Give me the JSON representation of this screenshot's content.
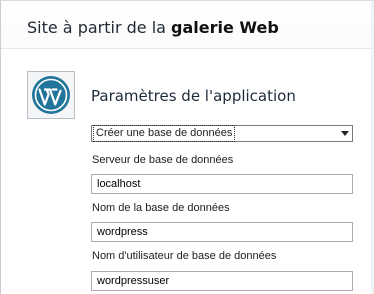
{
  "header": {
    "title_prefix": "Site à partir de la ",
    "title_bold": "galerie Web"
  },
  "app": {
    "logo_icon": "wordpress-icon",
    "section_title": "Paramètres de l'application"
  },
  "database_mode": {
    "selected": "Créer une base de données"
  },
  "fields": [
    {
      "label": "Serveur de base de données",
      "value": "localhost"
    },
    {
      "label": "Nom de la base de données",
      "value": "wordpress"
    },
    {
      "label": "Nom d'utilisateur de base de données",
      "value": "wordpressuser"
    }
  ],
  "colors": {
    "wordpress_blue": "#21759b",
    "border": "#abadb3"
  }
}
